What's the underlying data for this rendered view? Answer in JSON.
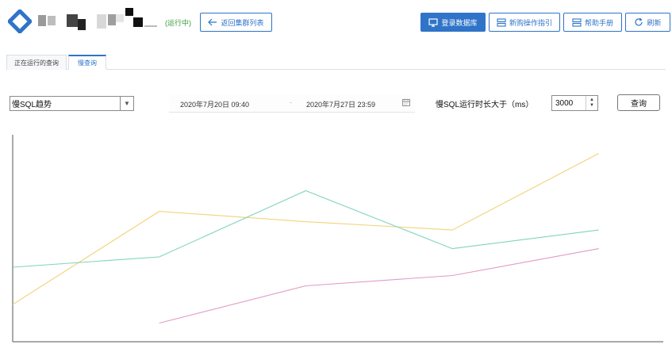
{
  "header": {
    "status": "(运行中)",
    "back_label": "返回集群列表",
    "buttons": [
      {
        "label": "登录数据库",
        "icon": "monitor-icon",
        "primary": true
      },
      {
        "label": "新购操作指引",
        "icon": "guide-icon",
        "primary": false
      },
      {
        "label": "帮助手册",
        "icon": "manual-icon",
        "primary": false
      },
      {
        "label": "刷新",
        "icon": "refresh-icon",
        "primary": false
      }
    ]
  },
  "tabs": [
    {
      "label": "正在运行的查询",
      "active": false
    },
    {
      "label": "慢查询",
      "active": true
    }
  ],
  "filters": {
    "view_select": "慢SQL趋势",
    "date_start": "2020年7月20日 09:40",
    "date_sep": "-",
    "date_end": "2020年7月27日 23:59",
    "duration_label": "慢SQL运行时长大于（ms）",
    "duration_value": "3000",
    "query_label": "查询"
  },
  "colors": {
    "accent": "#2f74c8",
    "series": [
      "#f2d27a",
      "#7fd3c0",
      "#e39ac2"
    ]
  },
  "chart_data": {
    "type": "line",
    "x": [
      0,
      1,
      2,
      3,
      4
    ],
    "xlim": [
      0,
      4.44
    ],
    "ylim": [
      0,
      100
    ],
    "grid": false,
    "series": [
      {
        "values": [
          18,
          63,
          58,
          54,
          91
        ]
      },
      {
        "values": [
          36,
          41,
          73,
          45,
          54
        ]
      },
      {
        "values": [
          null,
          9,
          27,
          32,
          45
        ]
      }
    ]
  }
}
